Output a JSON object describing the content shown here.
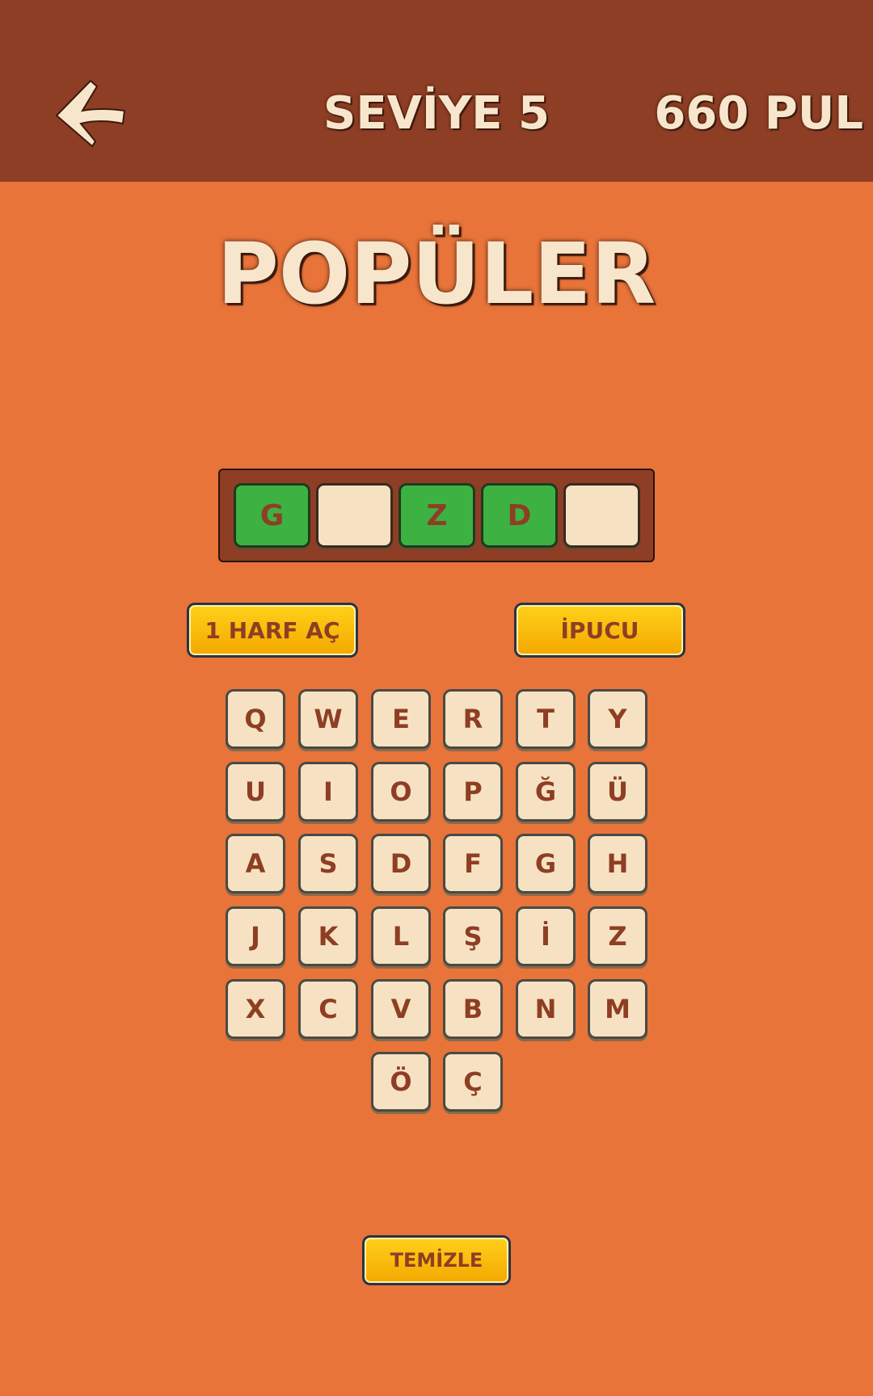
{
  "header": {
    "back_icon": "back-arrow-icon",
    "level_title": "SEVİYE 5",
    "coins": "660 PUL"
  },
  "category": "POPÜLER",
  "answer": {
    "slots": [
      {
        "letter": "G",
        "state": "filled"
      },
      {
        "letter": "",
        "state": "empty"
      },
      {
        "letter": "Z",
        "state": "filled"
      },
      {
        "letter": "D",
        "state": "filled"
      },
      {
        "letter": "",
        "state": "empty"
      }
    ]
  },
  "actions": {
    "reveal_letter": "1 HARF AÇ",
    "hint": "İPUCU",
    "clear": "TEMİZLE"
  },
  "keyboard": {
    "rows": [
      [
        "Q",
        "W",
        "E",
        "R",
        "T",
        "Y"
      ],
      [
        "U",
        "I",
        "O",
        "P",
        "Ğ",
        "Ü"
      ],
      [
        "A",
        "S",
        "D",
        "F",
        "G",
        "H"
      ],
      [
        "J",
        "K",
        "L",
        "Ş",
        "İ",
        "Z"
      ],
      [
        "X",
        "C",
        "V",
        "B",
        "N",
        "M"
      ],
      [
        "Ö",
        "Ç"
      ]
    ]
  },
  "colors": {
    "background": "#E8743A",
    "header": "#8E3E24",
    "tile": "#F6E2C2",
    "correct": "#3DB142",
    "button": "#FFC107"
  }
}
